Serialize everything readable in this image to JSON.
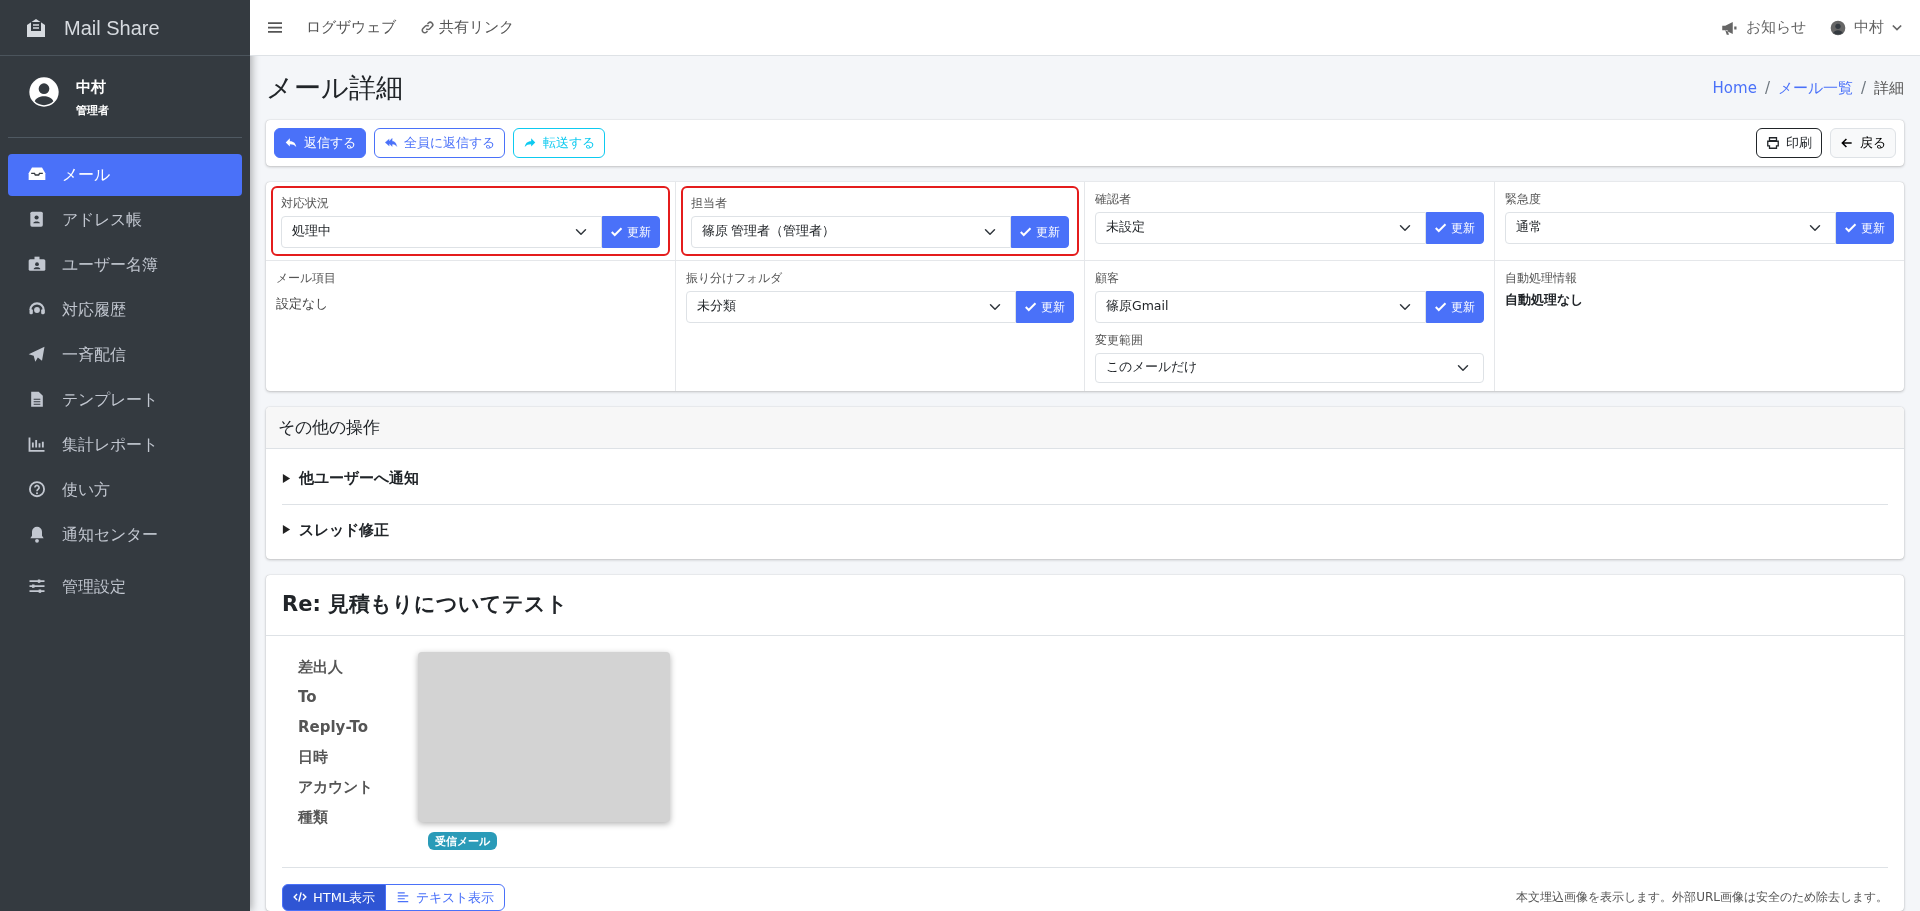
{
  "sidebar": {
    "brand": "Mail Share",
    "user": {
      "name": "中村",
      "role": "管理者"
    },
    "items": [
      {
        "label": "メール",
        "selected": true
      },
      {
        "label": "アドレス帳",
        "selected": false
      },
      {
        "label": "ユーザー名簿",
        "selected": false
      },
      {
        "label": "対応履歴",
        "selected": false
      },
      {
        "label": "一斉配信",
        "selected": false
      },
      {
        "label": "テンプレート",
        "selected": false
      },
      {
        "label": "集計レポート",
        "selected": false
      },
      {
        "label": "使い方",
        "selected": false
      },
      {
        "label": "通知センター",
        "selected": false
      },
      {
        "label": "管理設定",
        "selected": false
      }
    ]
  },
  "topbar": {
    "links": [
      "ログザウェブ",
      "共有リンク"
    ],
    "notice": "お知らせ",
    "user": "中村"
  },
  "page": {
    "title": "メール詳細",
    "breadcrumb": [
      {
        "kind": "link",
        "label": "Home"
      },
      {
        "kind": "separator",
        "label": "/"
      },
      {
        "kind": "link",
        "label": "メール一覧"
      },
      {
        "kind": "separator",
        "label": "/"
      },
      {
        "kind": "current",
        "label": "詳細"
      }
    ]
  },
  "toolbar": {
    "left": [
      "返信する",
      "全員に返信する",
      "転送する"
    ],
    "right": [
      "印刷",
      "戻る"
    ]
  },
  "fields": [
    {
      "label": "対応状況",
      "kind": "select",
      "value": "処理中",
      "button": "更新",
      "highlighted": true
    },
    {
      "label": "担当者",
      "kind": "select",
      "value": "篠原 管理者（管理者）",
      "button": "更新",
      "highlighted": true
    },
    {
      "label": "確認者",
      "kind": "select",
      "value": "未設定",
      "button": "更新",
      "highlighted": false
    },
    {
      "label": "緊急度",
      "kind": "select",
      "value": "通常",
      "button": "更新",
      "highlighted": false
    },
    {
      "label": "メール項目",
      "kind": "text",
      "value": "設定なし"
    },
    {
      "label": "振り分けフォルダ",
      "kind": "select",
      "value": "未分類",
      "button": "更新",
      "highlighted": false
    },
    {
      "label": "顧客",
      "kind": "select",
      "value": "篠原Gmail",
      "button": "更新",
      "highlighted": false,
      "scope": {
        "label": "変更範囲",
        "value": "このメールだけ"
      }
    },
    {
      "label": "自動処理情報",
      "kind": "info",
      "value": "自動処理なし"
    }
  ],
  "other_operations": {
    "title": "その他の操作",
    "sections": [
      {
        "label": "他ユーザーへ通知",
        "expanded": false
      },
      {
        "label": "スレッド修正",
        "expanded": false
      }
    ]
  },
  "mail": {
    "subject": "Re: 見積もりについてテスト",
    "meta_labels": [
      "差出人",
      "To",
      "Reply-To",
      "日時",
      "アカウント",
      "種類"
    ],
    "type_badge": "受信メール",
    "view_modes": [
      {
        "label": "HTML表示",
        "selected": true
      },
      {
        "label": "テキスト表示",
        "selected": false
      }
    ],
    "note": "本文埋込画像を表示します。外部URL画像は安全のため除去します。"
  }
}
